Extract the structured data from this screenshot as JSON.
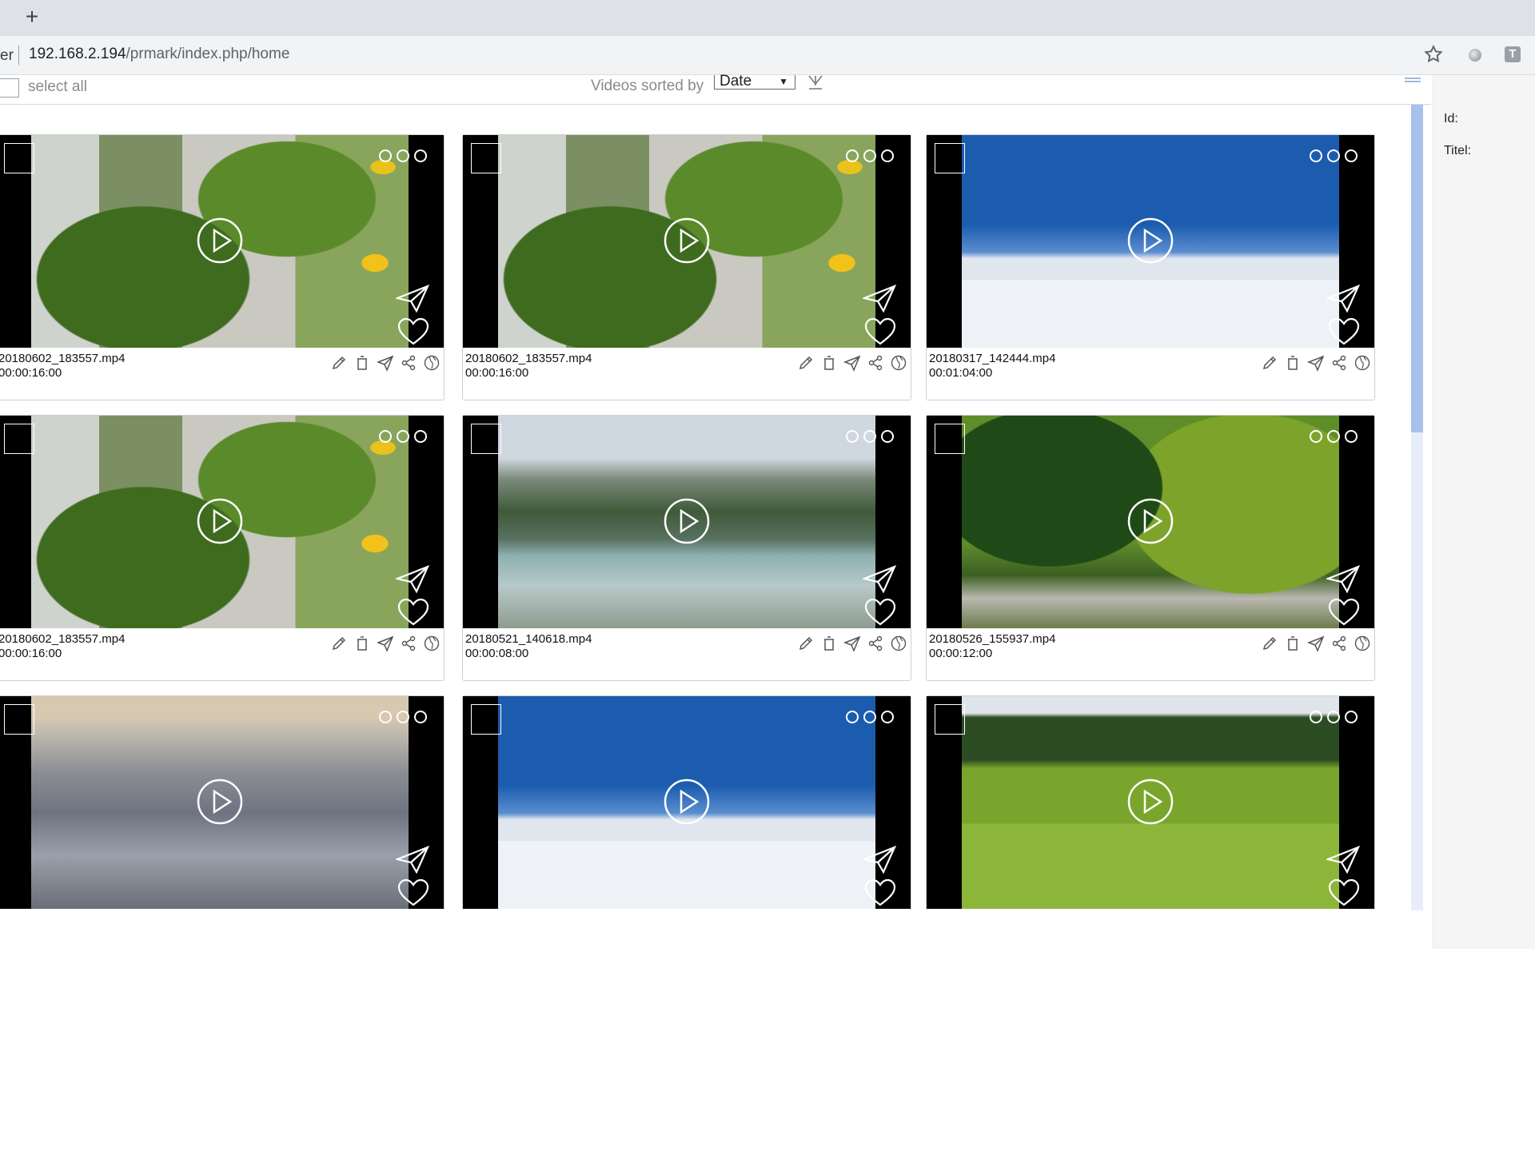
{
  "browser": {
    "tab_fragment": "er",
    "url_host": "192.168.2.194",
    "url_path": "/prmark/index.php/home",
    "new_tab_label": "+",
    "extension_letter": "T"
  },
  "toolbar": {
    "select_all_label": "select all",
    "sort_label": "Videos sorted by",
    "sort_value": "Date"
  },
  "side_panel": {
    "id_label": "Id:",
    "title_label": "Titel:"
  },
  "videos": [
    {
      "filename": "20180602_183557.mp4",
      "duration": "00:00:16:00",
      "scene": "tomato"
    },
    {
      "filename": "20180602_183557.mp4",
      "duration": "00:00:16:00",
      "scene": "tomato"
    },
    {
      "filename": "20180317_142444.mp4",
      "duration": "00:01:04:00",
      "scene": "sea"
    },
    {
      "filename": "20180602_183557.mp4",
      "duration": "00:00:16:00",
      "scene": "tomato"
    },
    {
      "filename": "20180521_140618.mp4",
      "duration": "00:00:08:00",
      "scene": "river"
    },
    {
      "filename": "20180526_155937.mp4",
      "duration": "00:00:12:00",
      "scene": "forest"
    },
    {
      "filename": "",
      "duration": "",
      "scene": "aerial"
    },
    {
      "filename": "",
      "duration": "",
      "scene": "sea"
    },
    {
      "filename": "",
      "duration": "",
      "scene": "field"
    }
  ],
  "icons": {
    "card_actions": [
      "pencil-icon",
      "trash-icon",
      "send-icon",
      "share-icon",
      "globe-icon"
    ],
    "overlay": [
      "checkbox",
      "more-dots-icon",
      "play-icon",
      "send-icon",
      "heart-icon"
    ]
  },
  "colors": {
    "scrollbar_thumb": "#a8c0ec",
    "chrome_tabstrip": "#dee1e6",
    "chrome_toolbar": "#f1f3f4"
  }
}
